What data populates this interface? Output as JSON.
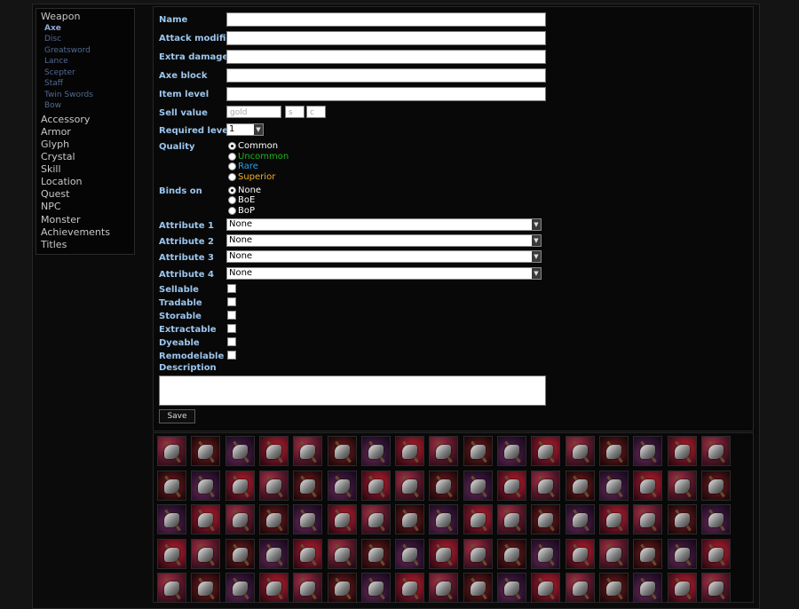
{
  "sidebar": {
    "weapon": {
      "label": "Weapon",
      "items": [
        "Axe",
        "Disc",
        "Greatsword",
        "Lance",
        "Scepter",
        "Staff",
        "Twin Swords",
        "Bow"
      ]
    },
    "categories": [
      "Accessory",
      "Armor",
      "Glyph",
      "Crystal",
      "Skill",
      "Location",
      "Quest",
      "NPC",
      "Monster",
      "Achievements",
      "Titles"
    ]
  },
  "form": {
    "name_label": "Name",
    "name_value": "",
    "attack_modifier_label": "Attack modifier",
    "attack_modifier_value": "",
    "extra_damage_label": "Extra damage",
    "extra_damage_value": "",
    "axe_block_label": "Axe block",
    "axe_block_value": "",
    "item_level_label": "Item level",
    "item_level_value": "",
    "sell_value_label": "Sell value",
    "sell_gold_placeholder": "gold",
    "sell_silver_placeholder": "s",
    "sell_copper_placeholder": "c",
    "required_level_label": "Required level",
    "required_level_value": "1",
    "quality_label": "Quality",
    "quality_options": [
      "Common",
      "Uncommon",
      "Rare",
      "Superior"
    ],
    "quality_colors": [
      "#ffffff",
      "#1db31d",
      "#2a9fe8",
      "#f0b020"
    ],
    "quality_selected": "Common",
    "binds_on_label": "Binds on",
    "binds_on_options": [
      "None",
      "BoE",
      "BoP"
    ],
    "binds_on_selected": "None",
    "attribute1_label": "Attribute 1",
    "attribute1_value": "None",
    "attribute2_label": "Attribute 2",
    "attribute2_value": "None",
    "attribute3_label": "Attribute 3",
    "attribute3_value": "None",
    "attribute4_label": "Attribute 4",
    "attribute4_value": "None",
    "sellable_label": "Sellable",
    "tradable_label": "Tradable",
    "storable_label": "Storable",
    "extractable_label": "Extractable",
    "dyeable_label": "Dyeable",
    "remodelable_label": "Remodelable",
    "description_label": "Description",
    "description_value": "",
    "save_label": "Save"
  },
  "icon_grid": {
    "icon_name": "axe-icon",
    "columns": 17,
    "rows_visible": 5
  }
}
